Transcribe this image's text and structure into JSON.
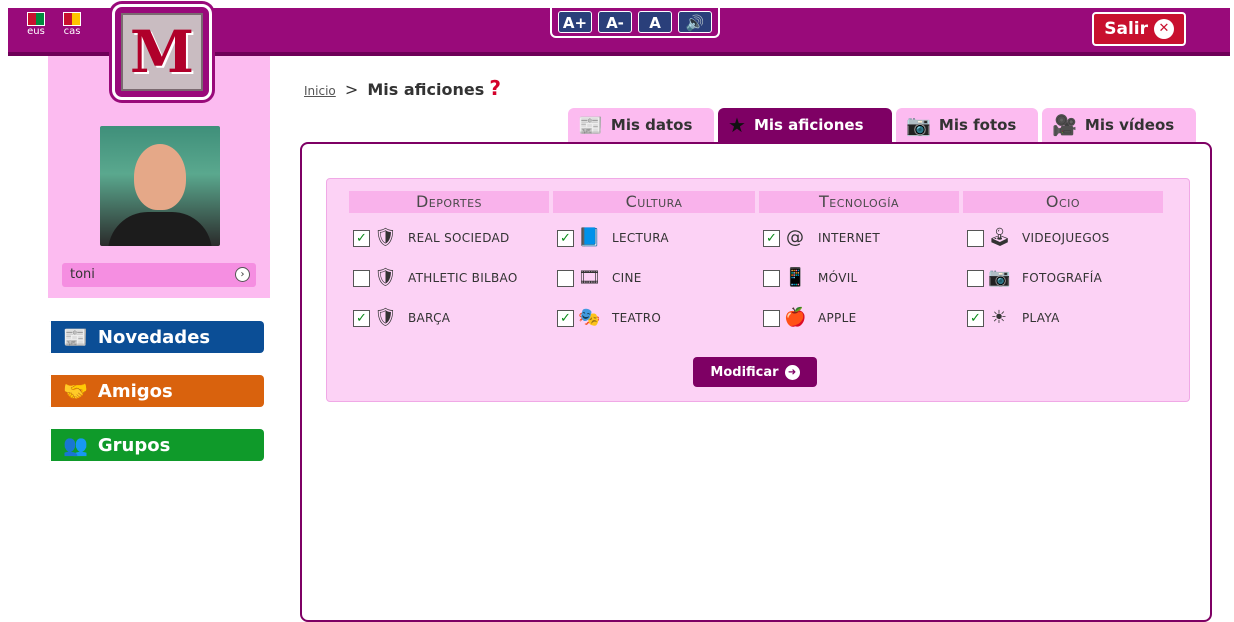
{
  "languages": [
    {
      "code": "eus",
      "flag_colors": [
        "#c8102e",
        "#008a3e"
      ]
    },
    {
      "code": "cas",
      "flag_colors": [
        "#c8102e",
        "#ffc400"
      ]
    }
  ],
  "accessibility": {
    "increase": "A+",
    "decrease": "A-",
    "contrast": "A",
    "audio": "◀)"
  },
  "logout_label": "Salir",
  "logo_letter": "M",
  "user": {
    "name": "toni"
  },
  "nav": {
    "novedades": "Novedades",
    "amigos": "Amigos",
    "grupos": "Grupos"
  },
  "breadcrumb": {
    "home": "Inicio",
    "separator": ">",
    "current": "Mis aficiones",
    "help": "?"
  },
  "tabs": {
    "datos": "Mis datos",
    "aficiones": "Mis aficiones",
    "fotos": "Mis fotos",
    "videos": "Mis vídeos"
  },
  "hobbies": {
    "deportes": {
      "header": "Deportes",
      "items": [
        {
          "label": "REAL SOCIEDAD",
          "checked": true,
          "icon": "real-sociedad-crest-icon"
        },
        {
          "label": "ATHLETIC BILBAO",
          "checked": false,
          "icon": "athletic-bilbao-crest-icon"
        },
        {
          "label": "BARÇA",
          "checked": true,
          "icon": "barca-crest-icon"
        }
      ]
    },
    "cultura": {
      "header": "Cultura",
      "items": [
        {
          "label": "LECTURA",
          "checked": true,
          "icon": "book-icon"
        },
        {
          "label": "CINE",
          "checked": false,
          "icon": "film-icon"
        },
        {
          "label": "TEATRO",
          "checked": true,
          "icon": "theater-masks-icon"
        }
      ]
    },
    "tecnologia": {
      "header": "Tecnología",
      "items": [
        {
          "label": "INTERNET",
          "checked": true,
          "icon": "at-sign-icon"
        },
        {
          "label": "MÓVIL",
          "checked": false,
          "icon": "mobile-phone-icon"
        },
        {
          "label": "APPLE",
          "checked": false,
          "icon": "apple-icon"
        }
      ]
    },
    "ocio": {
      "header": "Ocio",
      "items": [
        {
          "label": "VIDEOJUEGOS",
          "checked": false,
          "icon": "joystick-icon"
        },
        {
          "label": "FOTOGRAFÍA",
          "checked": false,
          "icon": "camera-icon"
        },
        {
          "label": "PLAYA",
          "checked": true,
          "icon": "sun-icon"
        }
      ]
    }
  },
  "modify_button": "Modificar",
  "colors": {
    "brand_purple": "#990a7a",
    "pink_panel": "#fcbbf0",
    "nav_blue": "#0b4e96",
    "nav_orange": "#d9620d",
    "nav_green": "#0f9a2a"
  }
}
